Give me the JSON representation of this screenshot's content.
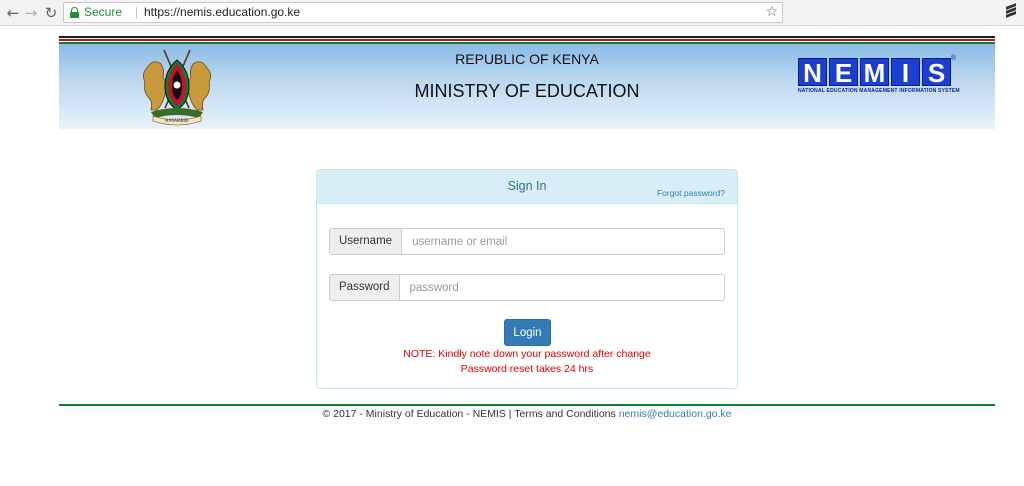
{
  "browser": {
    "secure_label": "Secure",
    "url": "https://nemis.education.go.ke"
  },
  "header": {
    "line1": "REPUBLIC OF KENYA",
    "line2": "MINISTRY OF EDUCATION",
    "logo_letters": [
      "N",
      "E",
      "M",
      "I",
      "S"
    ],
    "logo_subtitle": "NATIONAL EDUCATION MANAGEMENT INFORMATION SYSTEM",
    "logo_registered": "®",
    "coat_of_arms_motto": "HARAMBEE"
  },
  "signin": {
    "title": "Sign In",
    "forgot_password": "Forgot password?",
    "username_label": "Username",
    "username_placeholder": "username or email",
    "password_label": "Password",
    "password_placeholder": "password",
    "login_button": "Login",
    "note_line1": "NOTE: Kindly note down your password after change",
    "note_line2": "Password reset takes 24 hrs"
  },
  "footer": {
    "text": "© 2017 - Ministry of Education - NEMIS | Terms and Conditions",
    "email": "nemis@education.go.ke"
  },
  "colors": {
    "primary": "#337ab7",
    "panel_heading_bg": "#d9edf7",
    "note": "#e00000",
    "flag_green": "#0b7d2e",
    "flag_red": "#c8102e",
    "nemis_blue": "#1c3fcf"
  },
  "icons": {
    "back": "back-arrow-icon",
    "forward": "forward-arrow-icon",
    "reload": "reload-icon",
    "lock": "lock-icon",
    "bookmark": "star-icon",
    "extension": "extension-icon"
  }
}
